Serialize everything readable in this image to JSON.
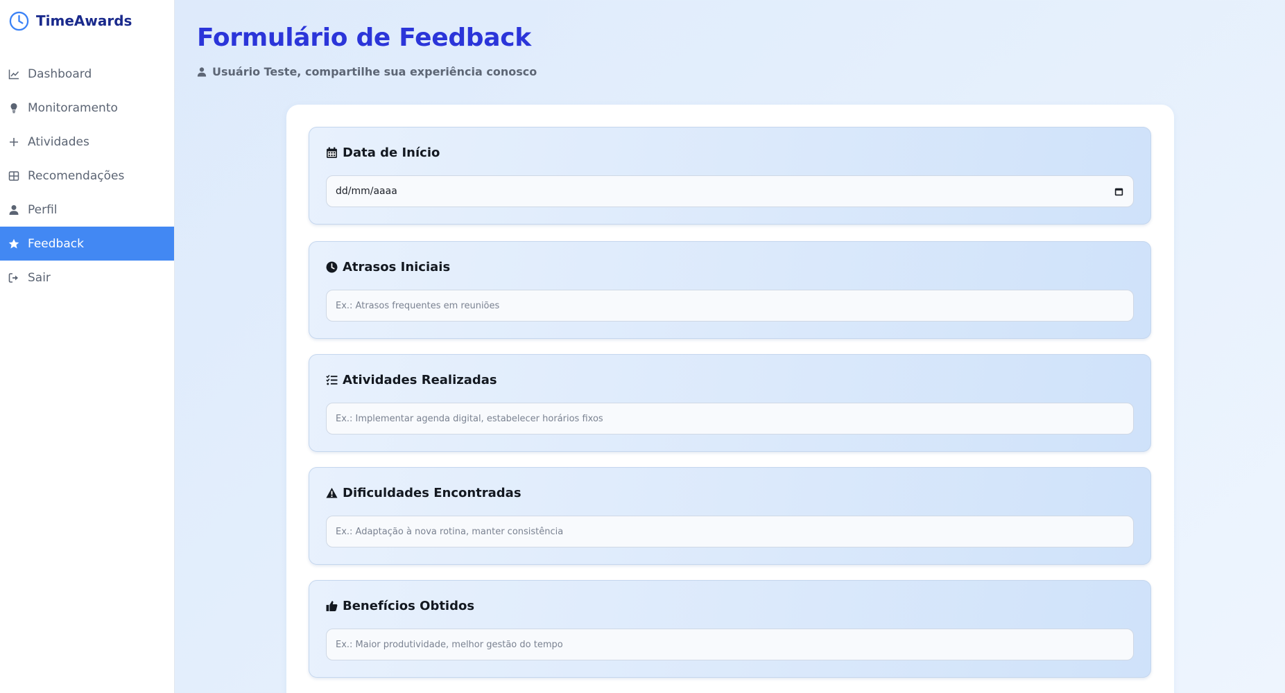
{
  "brand": {
    "name": "TimeAwards",
    "accent": "#1a2a8c",
    "logo_color": "#3b82f6"
  },
  "sidebar": {
    "items": [
      {
        "label": "Dashboard",
        "icon": "chart-line-icon",
        "active": false
      },
      {
        "label": "Monitoramento",
        "icon": "lightbulb-icon",
        "active": false
      },
      {
        "label": "Atividades",
        "icon": "plus-icon",
        "active": false
      },
      {
        "label": "Recomendações",
        "icon": "grid-icon",
        "active": false
      },
      {
        "label": "Perfil",
        "icon": "user-icon",
        "active": false
      },
      {
        "label": "Feedback",
        "icon": "star-icon",
        "active": true
      },
      {
        "label": "Sair",
        "icon": "logout-icon",
        "active": false
      }
    ],
    "active_color": "#4288f3"
  },
  "header": {
    "title": "Formulário de Feedback",
    "subtitle": "Usuário Teste, compartilhe sua experiência conosco",
    "title_color": "#2b35d9"
  },
  "form": {
    "start_date": {
      "label": "Data de Início",
      "icon": "calendar-icon",
      "value": "dd/mm/aaaa"
    },
    "initial_delays": {
      "label": "Atrasos Iniciais",
      "icon": "clock-icon",
      "placeholder": "Ex.: Atrasos frequentes em reuniões"
    },
    "activities_done": {
      "label": "Atividades Realizadas",
      "icon": "checklist-icon",
      "placeholder": "Ex.: Implementar agenda digital, estabelecer horários fixos"
    },
    "difficulties": {
      "label": "Dificuldades Encontradas",
      "icon": "warning-icon",
      "placeholder": "Ex.: Adaptação à nova rotina, manter consistência"
    },
    "benefits": {
      "label": "Benefícios Obtidos",
      "icon": "thumbs-up-icon",
      "placeholder": "Ex.: Maior produtividade, melhor gestão do tempo"
    }
  }
}
